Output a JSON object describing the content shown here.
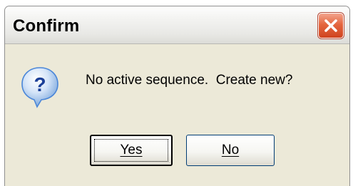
{
  "dialog": {
    "title": "Confirm",
    "message": "No active sequence.  Create new?",
    "icon": "question-icon",
    "close_icon": "close-icon",
    "buttons": {
      "yes_label": "Yes",
      "no_label": "No"
    }
  },
  "colors": {
    "face": "#ece9d8",
    "close_button": "#e4663f",
    "icon_bubble": "#4a86d8"
  }
}
